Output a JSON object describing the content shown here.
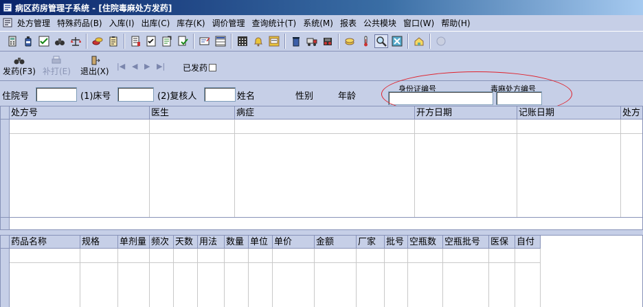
{
  "window": {
    "title": "病区药房管理子系统 - [住院毒麻处方发药]"
  },
  "menu": [
    "处方管理",
    "特殊药品(B)",
    "入库(I)",
    "出库(C)",
    "库存(K)",
    "调价管理",
    "查询统计(T)",
    "系统(M)",
    "报表",
    "公共模块",
    "窗口(W)",
    "帮助(H)"
  ],
  "toolbar_icons": [
    "calculator-icon",
    "bottle-icon",
    "check-icon",
    "binoculars-icon",
    "scale-icon",
    "coins-icon",
    "clipboard-icon",
    "checklist-icon",
    "document-icon",
    "approve-icon",
    "form-icon",
    "screen-icon",
    "grid-icon",
    "bell-icon",
    "calendar-icon",
    "trash-icon",
    "stamp-icon",
    "truck-icon",
    "folder-icon",
    "thermometer-icon",
    "magnifier-icon",
    "close-box-icon",
    "house-icon",
    "globe-icon"
  ],
  "actions": {
    "dispense": "发药(F3)",
    "reprint": "补打(E)",
    "exit": "退出(X)",
    "dispensed_label": "已发药"
  },
  "filter": {
    "inpatient_no": "住院号",
    "bed_no": "(1)床号",
    "reviewer": "(2)复核人",
    "name": "姓名",
    "gender": "性别",
    "age": "年龄",
    "id_card": "身份证编号",
    "narcotic_rx_no": "毒麻处方编号"
  },
  "rx_table": {
    "columns": [
      "处方号",
      "医生",
      "病症",
      "开方日期",
      "记账日期",
      "处方"
    ]
  },
  "drug_table": {
    "columns": [
      "药品名称",
      "规格",
      "单剂量",
      "频次",
      "天数",
      "用法",
      "数量",
      "单位",
      "单价",
      "金额",
      "厂家",
      "批号",
      "空瓶数",
      "空瓶批号",
      "医保",
      "自付"
    ]
  }
}
